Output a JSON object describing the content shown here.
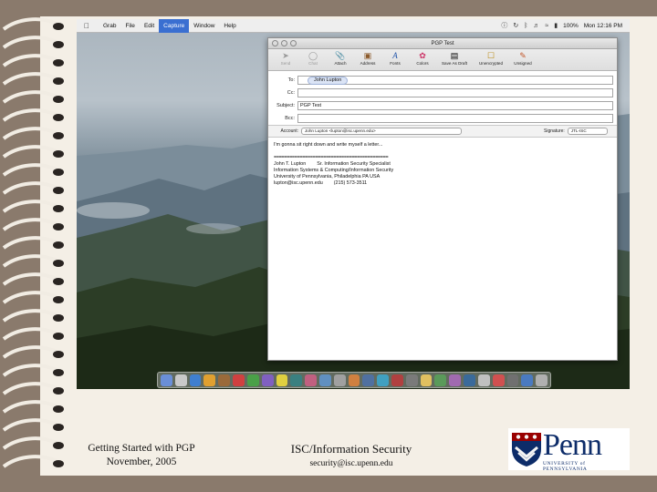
{
  "menubar": {
    "items": [
      "Grab",
      "File",
      "Edit",
      "Capture",
      "Window",
      "Help"
    ],
    "active_item": "Capture",
    "battery": "100%",
    "clock": "Mon 12:16 PM"
  },
  "mail_window": {
    "title": "PGP Test",
    "toolbar": [
      "Send",
      "Chat",
      "Attach",
      "Address",
      "Fonts",
      "Colors",
      "Save As Draft",
      "Unencrypted",
      "Unsigned"
    ],
    "headers": {
      "to_label": "To:",
      "to_value": "John Lupton",
      "cc_label": "Cc:",
      "subject_label": "Subject:",
      "subject_value": "PGP Test",
      "bcc_label": "Bcc:"
    },
    "account_label": "Account:",
    "account_value": "John Lupton <lupton@isc.upenn.edu>",
    "signature_label": "Signature:",
    "signature_value": "JTL-ISC",
    "body_lines": [
      "I'm gonna sit right down and write myself a letter...",
      "============================================",
      "John T. Lupton        Sr. Information Security Specialist",
      "Information Systems & Computing/Information Security",
      "University of Pennsylvania, Philadelphia PA USA",
      "lupton@isc.upenn.edu        (215) 573-3511"
    ]
  },
  "footer": {
    "left_line1": "Getting Started with PGP",
    "left_line2": "November, 2005",
    "center_title": "ISC/Information Security",
    "center_email": "security@isc.upenn.edu",
    "logo_word": "Penn",
    "logo_sub": "UNIVERSITY of PENNSYLVANIA"
  },
  "colors": {
    "menu_highlight": "#3a6fd1",
    "penn_blue": "#0d2c69",
    "penn_red": "#990000"
  },
  "icons": [
    "apple-icon",
    "help-icon",
    "sync-icon",
    "bluetooth-icon",
    "volume-icon",
    "wifi-icon",
    "battery-icon"
  ]
}
